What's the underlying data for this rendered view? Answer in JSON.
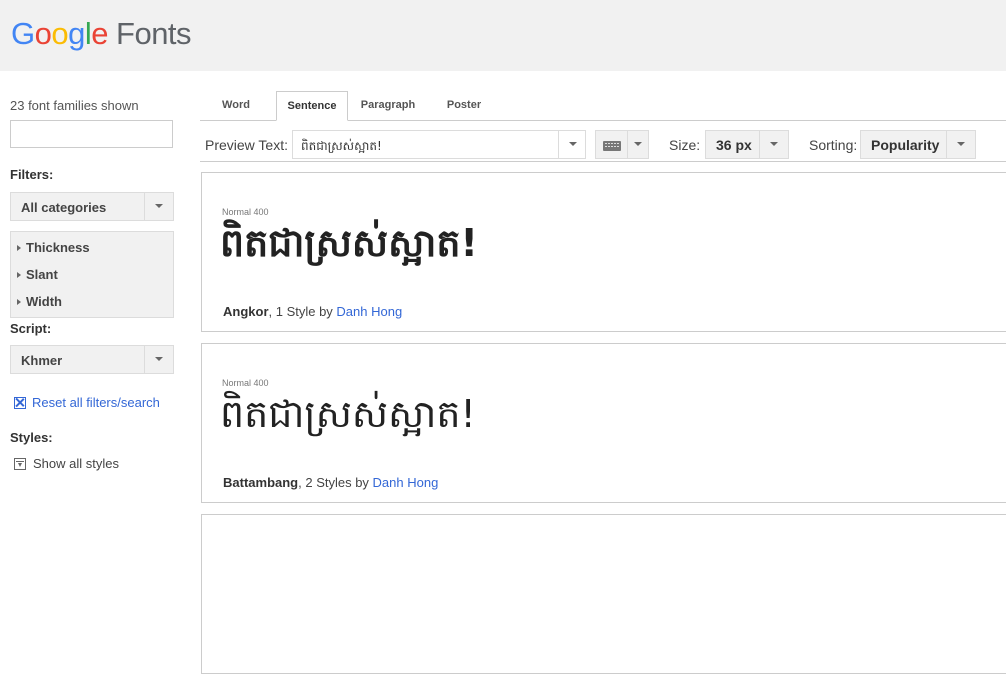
{
  "header": {
    "logo_letters": [
      "G",
      "o",
      "o",
      "g",
      "l",
      "e"
    ],
    "logo_suffix": "Fonts"
  },
  "sidebar": {
    "count_text": "23 font families shown",
    "search_value": "",
    "filters_title": "Filters:",
    "category_select": "All categories",
    "filter_items": [
      "Thickness",
      "Slant",
      "Width"
    ],
    "script_title": "Script:",
    "script_select": "Khmer",
    "reset_link": "Reset all filters/search",
    "styles_title": "Styles:",
    "show_styles": "Show all styles"
  },
  "tabs": [
    {
      "label": "Word",
      "active": false
    },
    {
      "label": "Sentence",
      "active": true
    },
    {
      "label": "Paragraph",
      "active": false
    },
    {
      "label": "Poster",
      "active": false
    }
  ],
  "toolbar": {
    "preview_label": "Preview Text:",
    "preview_value": "ពិតជាស្រស់ស្អាត!",
    "size_label": "Size:",
    "size_value": "36 px",
    "sorting_label": "Sorting:",
    "sorting_value": "Popularity"
  },
  "cards": [
    {
      "style_label": "Normal 400",
      "preview_text": "ពិតជាស្រស់ស្អាត!",
      "font_name": "Angkor",
      "styles_text": ", 1 Style by ",
      "author": "Danh Hong"
    },
    {
      "style_label": "Normal 400",
      "preview_text": "ពិតជាស្រស់ស្អាត!",
      "font_name": "Battambang",
      "styles_text": ", 2 Styles by ",
      "author": "Danh Hong"
    }
  ],
  "colors": {
    "link": "#3367d6",
    "header_bg": "#f1f1f1",
    "google_blue": "#4285f4",
    "google_red": "#ea4335",
    "google_yellow": "#fbbc05",
    "google_green": "#34a853"
  }
}
